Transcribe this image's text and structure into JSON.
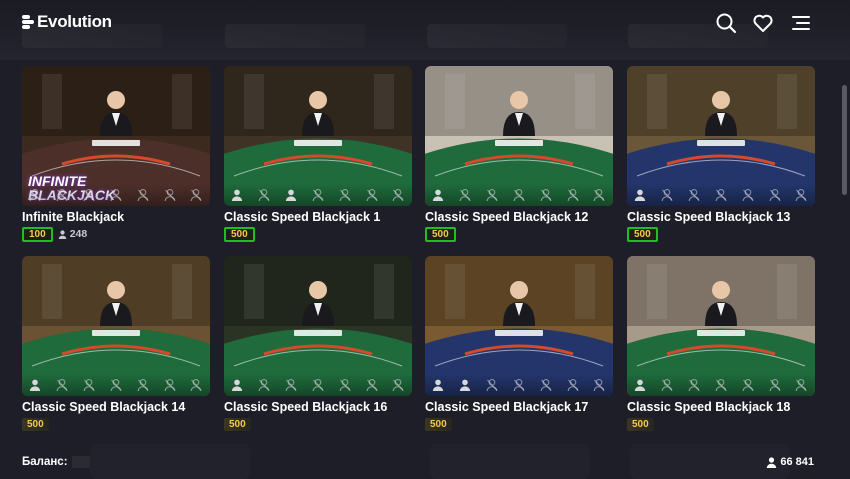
{
  "header": {
    "brand": "Evolution",
    "icons": [
      "search-icon",
      "heart-icon",
      "menu-icon"
    ]
  },
  "tables": [
    {
      "name": "Infinite Blackjack",
      "min_bet": "100",
      "players": "248",
      "felt": "#4d2f2a",
      "wall": "#3b2a1d",
      "highlight": true,
      "logo_text": "INFINITE BLACKJACK"
    },
    {
      "name": "Classic Speed Blackjack 1",
      "min_bet": "500",
      "players": "",
      "felt": "#1f6b3c",
      "wall": "#3f3326",
      "highlight": true,
      "logo_text": ""
    },
    {
      "name": "Classic Speed Blackjack 12",
      "min_bet": "500",
      "players": "",
      "felt": "#1f6b3c",
      "wall": "#c9c1b4",
      "highlight": true,
      "logo_text": ""
    },
    {
      "name": "Classic Speed Blackjack 13",
      "min_bet": "500",
      "players": "",
      "felt": "#23356b",
      "wall": "#6a5638",
      "highlight": true,
      "logo_text": ""
    },
    {
      "name": "Classic Speed Blackjack 14",
      "min_bet": "500",
      "players": "",
      "felt": "#1f6b3c",
      "wall": "#6b5232",
      "highlight": false,
      "logo_text": ""
    },
    {
      "name": "Classic Speed Blackjack 16",
      "min_bet": "500",
      "players": "",
      "felt": "#1f6b3c",
      "wall": "#2b3324",
      "highlight": false,
      "logo_text": ""
    },
    {
      "name": "Classic Speed Blackjack 17",
      "min_bet": "500",
      "players": "",
      "felt": "#23356b",
      "wall": "#7a5a30",
      "highlight": false,
      "logo_text": ""
    },
    {
      "name": "Classic Speed Blackjack 18",
      "min_bet": "500",
      "players": "",
      "felt": "#1f6b3c",
      "wall": "#a89a88",
      "highlight": false,
      "logo_text": ""
    }
  ],
  "footer": {
    "balance_label": "Баланс:",
    "total_players": "66 841"
  },
  "colors": {
    "background": "#1e1e28",
    "bet_text": "#f6c94b",
    "highlight_box": "#1fbf1f"
  }
}
